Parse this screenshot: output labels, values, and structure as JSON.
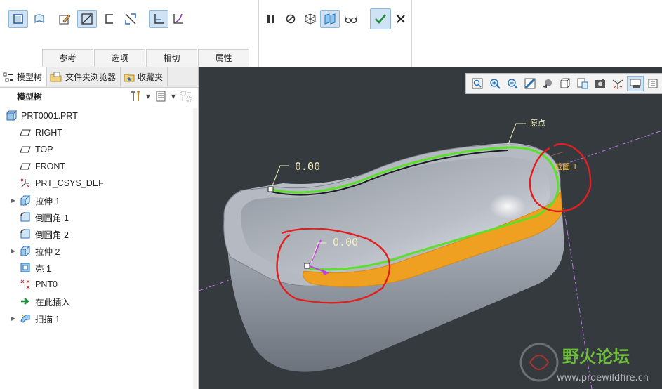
{
  "ribbon": {
    "left_tools": [
      "solid-icon",
      "surface-icon",
      "sketch-icon",
      "section-normal-icon",
      "section-open-icon",
      "section-custom-icon",
      "horizontal-vertical-icon",
      "curve-icon"
    ],
    "right_tools": [
      "pause-icon",
      "no-preview-icon",
      "mesh-preview-icon",
      "verify-icon",
      "glasses-icon",
      "ok-icon",
      "cancel-icon"
    ],
    "option_tabs": [
      "参考",
      "选项",
      "相切",
      "属性"
    ]
  },
  "sidebar": {
    "tabs": [
      {
        "label": "模型树",
        "icon": "model-tree-icon"
      },
      {
        "label": "文件夹浏览器",
        "icon": "folder-icon"
      },
      {
        "label": "收藏夹",
        "icon": "favorites-icon"
      }
    ],
    "tree_title": "模型树",
    "items": [
      {
        "label": "PRT0001.PRT",
        "icon": "part-icon",
        "expander": "",
        "indent": 0
      },
      {
        "label": "RIGHT",
        "icon": "datum-plane-icon",
        "expander": "",
        "indent": 1
      },
      {
        "label": "TOP",
        "icon": "datum-plane-icon",
        "expander": "",
        "indent": 1
      },
      {
        "label": "FRONT",
        "icon": "datum-plane-icon",
        "expander": "",
        "indent": 1
      },
      {
        "label": "PRT_CSYS_DEF",
        "icon": "csys-icon",
        "expander": "",
        "indent": 1
      },
      {
        "label": "拉伸 1",
        "icon": "extrude-icon",
        "expander": "▶",
        "indent": 1
      },
      {
        "label": "倒圆角 1",
        "icon": "round-icon",
        "expander": "",
        "indent": 1
      },
      {
        "label": "倒圆角 2",
        "icon": "round-icon",
        "expander": "",
        "indent": 1
      },
      {
        "label": "拉伸 2",
        "icon": "extrude-icon",
        "expander": "▶",
        "indent": 1
      },
      {
        "label": "壳 1",
        "icon": "shell-icon",
        "expander": "",
        "indent": 1
      },
      {
        "label": "PNT0",
        "icon": "datum-point-icon",
        "expander": "",
        "indent": 1
      },
      {
        "label": "在此插入",
        "icon": "insert-here-icon",
        "expander": "",
        "indent": 1
      },
      {
        "label": "扫描 1",
        "icon": "sweep-icon",
        "expander": "▶",
        "indent": 1
      }
    ]
  },
  "viewport": {
    "toolbar": [
      "refit-icon",
      "zoom-in-icon",
      "zoom-out-icon",
      "repaint-icon",
      "display-style-icon",
      "saved-views-icon",
      "view-manager-icon",
      "perspective-icon",
      "datum-display-icon",
      "annotation-display-icon",
      "spin-center-icon"
    ],
    "annotations": {
      "dim1": "0.00",
      "dim2": "0.00",
      "origin_label": "原点",
      "section_label": "截面 1"
    },
    "watermark": {
      "title": "野火论坛",
      "url": "www.proewildfire.cn"
    },
    "colors": {
      "background": "#353a3f",
      "trajectory": "#5ce02a",
      "sweep_fill": "#f0a020",
      "markup": "#e02020",
      "datum": "#c77dff",
      "dimension": "#f4f0c0"
    }
  }
}
